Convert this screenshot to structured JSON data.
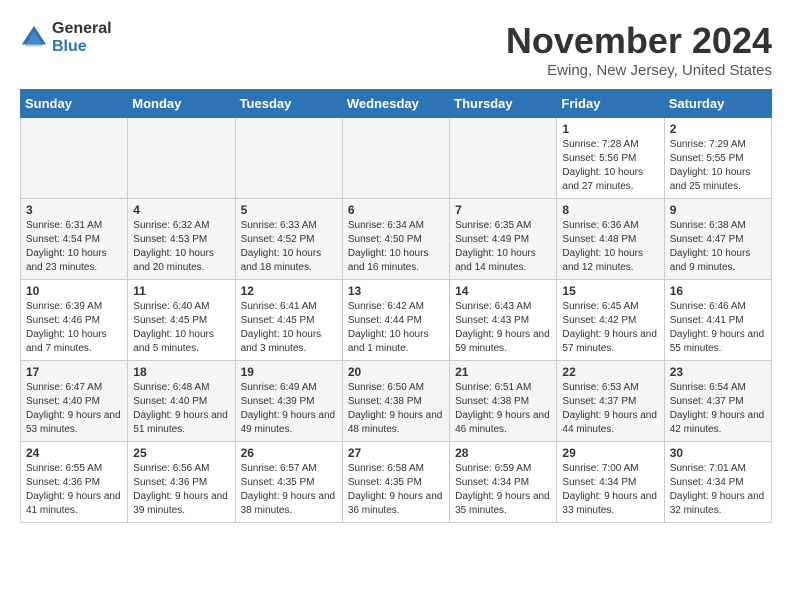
{
  "header": {
    "logo_general": "General",
    "logo_blue": "Blue",
    "title": "November 2024",
    "subtitle": "Ewing, New Jersey, United States"
  },
  "days_of_week": [
    "Sunday",
    "Monday",
    "Tuesday",
    "Wednesday",
    "Thursday",
    "Friday",
    "Saturday"
  ],
  "weeks": [
    [
      {
        "day": "",
        "info": ""
      },
      {
        "day": "",
        "info": ""
      },
      {
        "day": "",
        "info": ""
      },
      {
        "day": "",
        "info": ""
      },
      {
        "day": "",
        "info": ""
      },
      {
        "day": "1",
        "info": "Sunrise: 7:28 AM\nSunset: 5:56 PM\nDaylight: 10 hours and 27 minutes."
      },
      {
        "day": "2",
        "info": "Sunrise: 7:29 AM\nSunset: 5:55 PM\nDaylight: 10 hours and 25 minutes."
      }
    ],
    [
      {
        "day": "3",
        "info": "Sunrise: 6:31 AM\nSunset: 4:54 PM\nDaylight: 10 hours and 23 minutes."
      },
      {
        "day": "4",
        "info": "Sunrise: 6:32 AM\nSunset: 4:53 PM\nDaylight: 10 hours and 20 minutes."
      },
      {
        "day": "5",
        "info": "Sunrise: 6:33 AM\nSunset: 4:52 PM\nDaylight: 10 hours and 18 minutes."
      },
      {
        "day": "6",
        "info": "Sunrise: 6:34 AM\nSunset: 4:50 PM\nDaylight: 10 hours and 16 minutes."
      },
      {
        "day": "7",
        "info": "Sunrise: 6:35 AM\nSunset: 4:49 PM\nDaylight: 10 hours and 14 minutes."
      },
      {
        "day": "8",
        "info": "Sunrise: 6:36 AM\nSunset: 4:48 PM\nDaylight: 10 hours and 12 minutes."
      },
      {
        "day": "9",
        "info": "Sunrise: 6:38 AM\nSunset: 4:47 PM\nDaylight: 10 hours and 9 minutes."
      }
    ],
    [
      {
        "day": "10",
        "info": "Sunrise: 6:39 AM\nSunset: 4:46 PM\nDaylight: 10 hours and 7 minutes."
      },
      {
        "day": "11",
        "info": "Sunrise: 6:40 AM\nSunset: 4:45 PM\nDaylight: 10 hours and 5 minutes."
      },
      {
        "day": "12",
        "info": "Sunrise: 6:41 AM\nSunset: 4:45 PM\nDaylight: 10 hours and 3 minutes."
      },
      {
        "day": "13",
        "info": "Sunrise: 6:42 AM\nSunset: 4:44 PM\nDaylight: 10 hours and 1 minute."
      },
      {
        "day": "14",
        "info": "Sunrise: 6:43 AM\nSunset: 4:43 PM\nDaylight: 9 hours and 59 minutes."
      },
      {
        "day": "15",
        "info": "Sunrise: 6:45 AM\nSunset: 4:42 PM\nDaylight: 9 hours and 57 minutes."
      },
      {
        "day": "16",
        "info": "Sunrise: 6:46 AM\nSunset: 4:41 PM\nDaylight: 9 hours and 55 minutes."
      }
    ],
    [
      {
        "day": "17",
        "info": "Sunrise: 6:47 AM\nSunset: 4:40 PM\nDaylight: 9 hours and 53 minutes."
      },
      {
        "day": "18",
        "info": "Sunrise: 6:48 AM\nSunset: 4:40 PM\nDaylight: 9 hours and 51 minutes."
      },
      {
        "day": "19",
        "info": "Sunrise: 6:49 AM\nSunset: 4:39 PM\nDaylight: 9 hours and 49 minutes."
      },
      {
        "day": "20",
        "info": "Sunrise: 6:50 AM\nSunset: 4:38 PM\nDaylight: 9 hours and 48 minutes."
      },
      {
        "day": "21",
        "info": "Sunrise: 6:51 AM\nSunset: 4:38 PM\nDaylight: 9 hours and 46 minutes."
      },
      {
        "day": "22",
        "info": "Sunrise: 6:53 AM\nSunset: 4:37 PM\nDaylight: 9 hours and 44 minutes."
      },
      {
        "day": "23",
        "info": "Sunrise: 6:54 AM\nSunset: 4:37 PM\nDaylight: 9 hours and 42 minutes."
      }
    ],
    [
      {
        "day": "24",
        "info": "Sunrise: 6:55 AM\nSunset: 4:36 PM\nDaylight: 9 hours and 41 minutes."
      },
      {
        "day": "25",
        "info": "Sunrise: 6:56 AM\nSunset: 4:36 PM\nDaylight: 9 hours and 39 minutes."
      },
      {
        "day": "26",
        "info": "Sunrise: 6:57 AM\nSunset: 4:35 PM\nDaylight: 9 hours and 38 minutes."
      },
      {
        "day": "27",
        "info": "Sunrise: 6:58 AM\nSunset: 4:35 PM\nDaylight: 9 hours and 36 minutes."
      },
      {
        "day": "28",
        "info": "Sunrise: 6:59 AM\nSunset: 4:34 PM\nDaylight: 9 hours and 35 minutes."
      },
      {
        "day": "29",
        "info": "Sunrise: 7:00 AM\nSunset: 4:34 PM\nDaylight: 9 hours and 33 minutes."
      },
      {
        "day": "30",
        "info": "Sunrise: 7:01 AM\nSunset: 4:34 PM\nDaylight: 9 hours and 32 minutes."
      }
    ]
  ]
}
